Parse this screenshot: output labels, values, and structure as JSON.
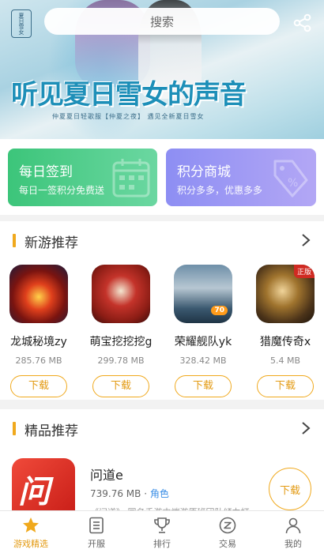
{
  "banner": {
    "title": "听见夏日雪女的声音",
    "subtitle": "仲夏夏日轻歌服【仲夏之夜】 遇见全新夏日雪女",
    "logo_text": "夏日雪女",
    "search_placeholder": "搜索",
    "search_icon": "search",
    "share_icon": "share-icon"
  },
  "cards": [
    {
      "title": "每日签到",
      "desc": "每日一签积分免费送",
      "color": "#3cc57a",
      "icon": "calendar-icon"
    },
    {
      "title": "积分商城",
      "desc": "积分多多，优惠多多",
      "color": "#8d8ef3",
      "icon": "tag-icon"
    }
  ],
  "new_games": {
    "title": "新游推荐",
    "accent": "#f0a91d",
    "items": [
      {
        "name": "龙城秘境zy",
        "size": "285.76 MB",
        "button": "下载"
      },
      {
        "name": "萌宝挖挖挖g",
        "size": "299.78 MB",
        "button": "下载"
      },
      {
        "name": "荣耀舰队yk",
        "size": "328.42 MB",
        "button": "下载",
        "badge": "70"
      },
      {
        "name": "猎魔传奇x",
        "size": "5.4 MB",
        "button": "下载",
        "badge": "正版"
      }
    ]
  },
  "featured": {
    "title": "精品推荐",
    "item": {
      "name": "问道e",
      "size": "739.76 MB",
      "separator": "·",
      "tag": "角色",
      "desc": "《问道》 同名手游中端游原班团队倾力打",
      "button": "下载",
      "icon_glyph": "问道"
    }
  },
  "tabbar": {
    "active_color": "#e39a12",
    "items": [
      {
        "label": "游戏精选",
        "icon": "star-icon",
        "active": true
      },
      {
        "label": "开服",
        "icon": "list-icon",
        "active": false
      },
      {
        "label": "排行",
        "icon": "trophy-icon",
        "active": false
      },
      {
        "label": "交易",
        "icon": "exchange-icon",
        "active": false
      },
      {
        "label": "我的",
        "icon": "user-icon",
        "active": false
      }
    ]
  }
}
